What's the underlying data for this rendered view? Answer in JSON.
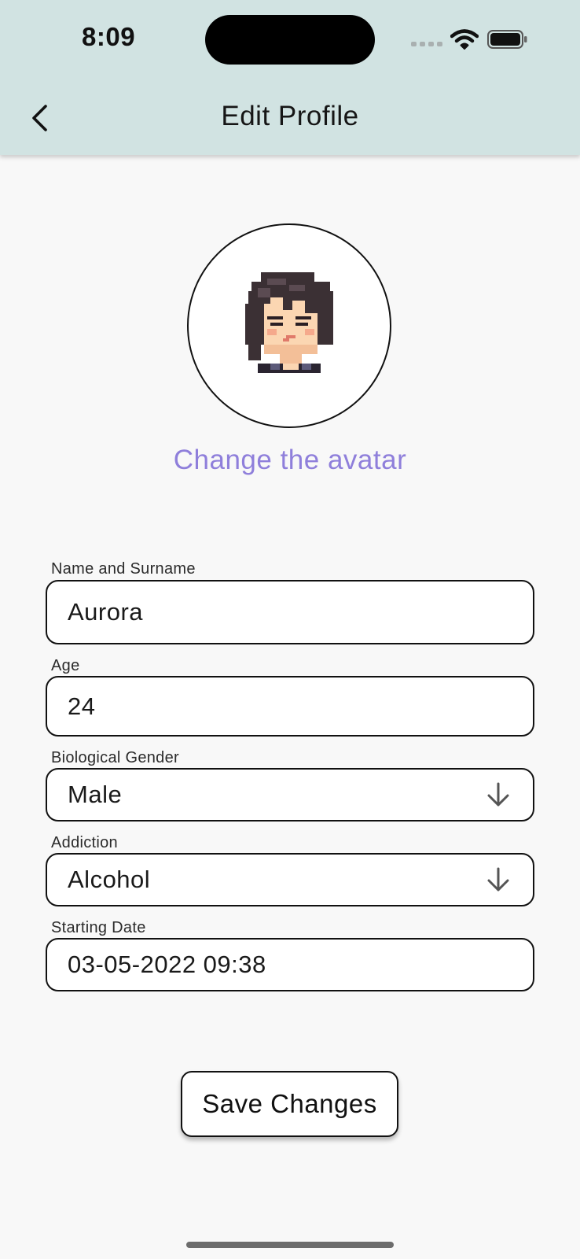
{
  "status_bar": {
    "time": "8:09"
  },
  "header": {
    "title": "Edit Profile",
    "back_icon": "chevron-left-icon"
  },
  "avatar": {
    "icon": "pixel-character-avatar",
    "change_label": "Change the avatar"
  },
  "form": {
    "name": {
      "label": "Name and Surname",
      "value": "Aurora"
    },
    "age": {
      "label": "Age",
      "value": "24"
    },
    "gender": {
      "label": "Biological Gender",
      "value": "Male",
      "icon": "arrow-down-icon"
    },
    "addiction": {
      "label": "Addiction",
      "value": "Alcohol",
      "icon": "arrow-down-icon"
    },
    "starting_date": {
      "label": "Starting Date",
      "value": "03-05-2022 09:38"
    }
  },
  "actions": {
    "save_label": "Save Changes"
  },
  "colors": {
    "header_bg": "#d1e3e2",
    "page_bg": "#f8f8f8",
    "accent_link": "#8f7fdb"
  }
}
